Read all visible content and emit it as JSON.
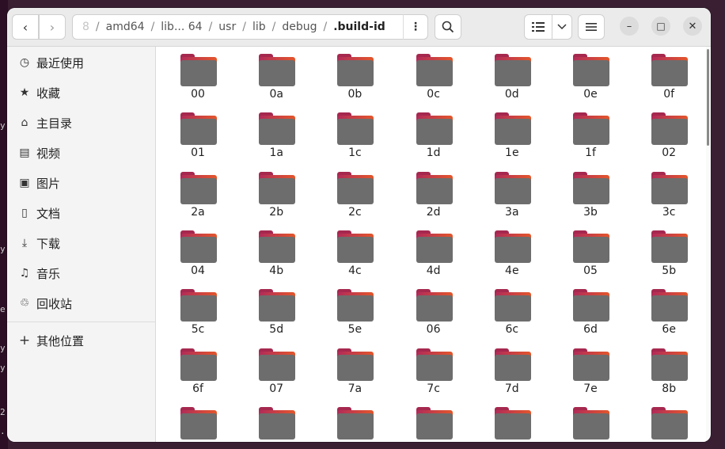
{
  "path": {
    "crumbs": [
      "8",
      "amd64",
      "lib... 64",
      "usr",
      "lib",
      "debug",
      ".build-id"
    ]
  },
  "sidebar": {
    "items": [
      {
        "label": "最近使用",
        "icon": "clock-icon"
      },
      {
        "label": "收藏",
        "icon": "star-icon"
      },
      {
        "label": "主目录",
        "icon": "home-icon"
      },
      {
        "label": "视频",
        "icon": "film-icon"
      },
      {
        "label": "图片",
        "icon": "image-icon"
      },
      {
        "label": "文档",
        "icon": "document-icon"
      },
      {
        "label": "下载",
        "icon": "download-icon"
      },
      {
        "label": "音乐",
        "icon": "music-icon"
      },
      {
        "label": "回收站",
        "icon": "trash-icon"
      }
    ],
    "other_locations": "其他位置"
  },
  "folders": [
    "00",
    "0a",
    "0b",
    "0c",
    "0d",
    "0e",
    "0f",
    "01",
    "1a",
    "1c",
    "1d",
    "1e",
    "1f",
    "02",
    "2a",
    "2b",
    "2c",
    "2d",
    "3a",
    "3b",
    "3c",
    "04",
    "4b",
    "4c",
    "4d",
    "4e",
    "05",
    "5b",
    "5c",
    "5d",
    "5e",
    "06",
    "6c",
    "6d",
    "6e",
    "6f",
    "07",
    "7a",
    "7c",
    "7d",
    "7e",
    "8b",
    "",
    "",
    "",
    "",
    "",
    "",
    ""
  ],
  "colors": {
    "folder_tab": "#a6284f",
    "folder_accent": "#e4562a",
    "folder_body": "#6d6d6d"
  }
}
